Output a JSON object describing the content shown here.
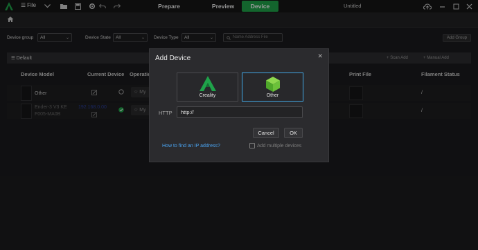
{
  "titlebar": {
    "file_label": "File",
    "tabs": [
      {
        "label": "Prepare",
        "active": false
      },
      {
        "label": "Preview",
        "active": false
      },
      {
        "label": "Device",
        "active": true
      }
    ],
    "doc_title": "Untitled",
    "accent_color": "#1fa34a"
  },
  "filters": {
    "device_group_label": "Device group",
    "device_group_value": "All",
    "device_state_label": "Device State",
    "device_state_value": "All",
    "device_type_label": "Device Type",
    "device_type_value": "All",
    "search_placeholder": "Name Address File",
    "add_group_label": "Add Group"
  },
  "group": {
    "name": "Default",
    "scan_add": "Scan Add",
    "manual_add": "Manual Add"
  },
  "table": {
    "headers": {
      "device_model": "Device Model",
      "current_device": "Current Device",
      "operation": "Operation",
      "print_file": "Print File",
      "filament_status": "Filament Status"
    },
    "rows": [
      {
        "model": "Other",
        "model_sub": "",
        "address": "",
        "op_text": "My",
        "filament": "/"
      },
      {
        "model": "Ender-3 V3 KE",
        "model_sub": "F005-MA0B",
        "address": "192.168.0.00",
        "op_text": "My",
        "filament": "/"
      }
    ]
  },
  "modal": {
    "title": "Add Device",
    "options": [
      {
        "label": "Creality",
        "selected": false
      },
      {
        "label": "Other",
        "selected": true
      }
    ],
    "http_label": "HTTP",
    "http_value": "http://",
    "cancel_label": "Cancel",
    "ok_label": "OK",
    "help_link": "How to find an IP address?",
    "multi_label": "Add multiple devices",
    "selected_color": "#41a9e8"
  }
}
